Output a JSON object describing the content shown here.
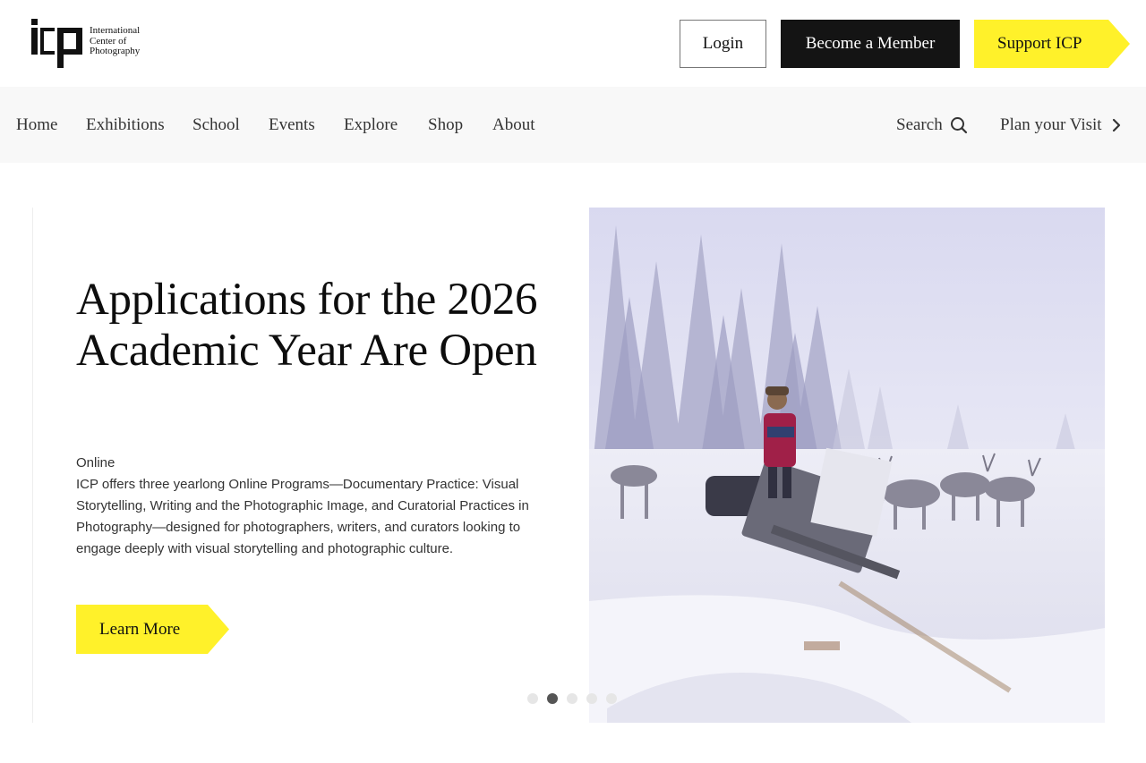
{
  "brand": {
    "logo_lines": [
      "International",
      "Center of",
      "Photography"
    ]
  },
  "header": {
    "login_label": "Login",
    "member_label": "Become a Member",
    "support_label": "Support ICP",
    "accent_yellow": "#FFF12A",
    "dark": "#141414"
  },
  "nav": {
    "items": [
      {
        "label": "Home"
      },
      {
        "label": "Exhibitions"
      },
      {
        "label": "School"
      },
      {
        "label": "Events"
      },
      {
        "label": "Explore"
      },
      {
        "label": "Shop"
      },
      {
        "label": "About"
      }
    ],
    "search_label": "Search",
    "search_icon": "search-icon",
    "visit_label": "Plan your Visit",
    "visit_icon": "chevron-right-icon"
  },
  "hero": {
    "title": "Applications for the 2026 Academic Year Are Open",
    "kicker": "Online",
    "body": "ICP offers three yearlong Online Programs—Documentary Practice: Visual Storytelling, Writing and the Photographic Image, and Curatorial Practices in Photography—designed for photographers, writers, and curators looking to engage deeply with visual storytelling and photographic culture.",
    "cta_label": "Learn More",
    "image_subject": "reindeer-herder-snowy-forest-photo",
    "slide_count": 5,
    "active_slide": 2
  }
}
